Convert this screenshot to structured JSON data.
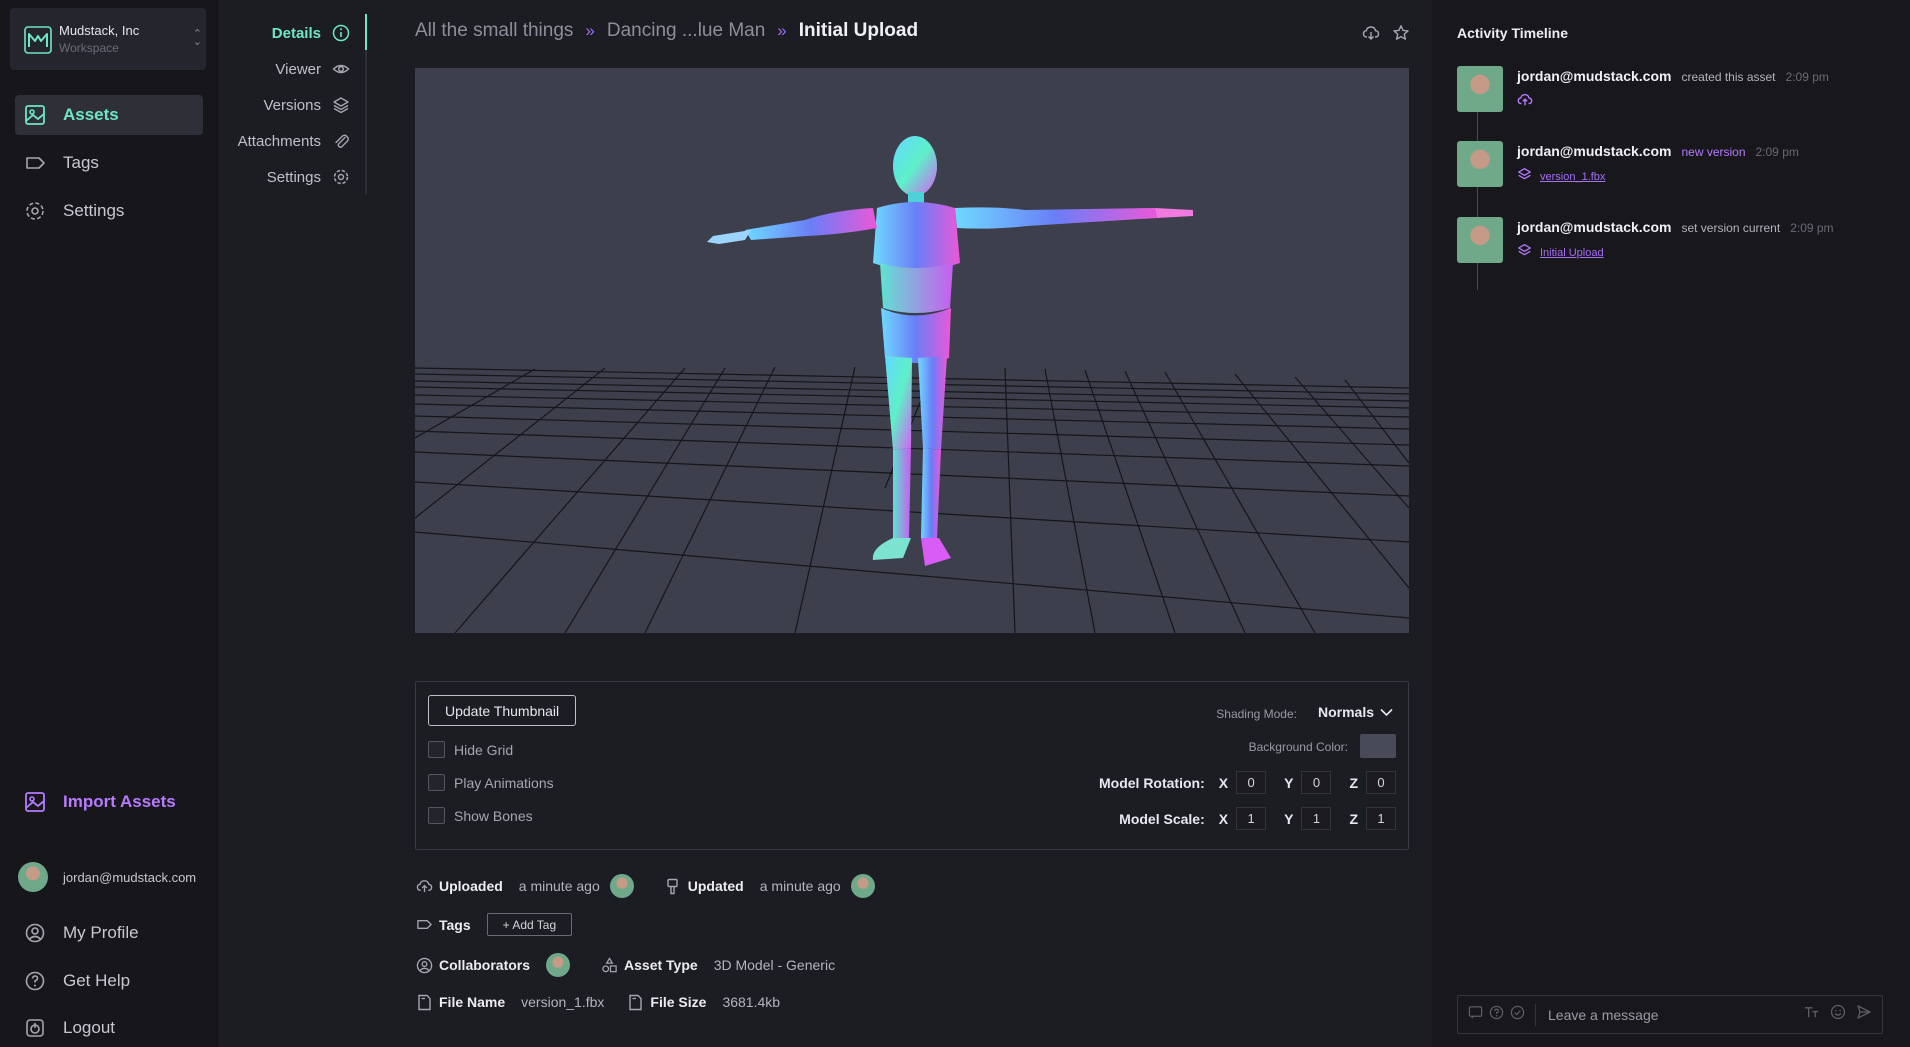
{
  "workspace": {
    "name": "Mudstack, Inc",
    "subtitle": "Workspace"
  },
  "sidebar": {
    "items": [
      {
        "label": "Assets",
        "icon": "image-icon",
        "active": true
      },
      {
        "label": "Tags",
        "icon": "tag-icon"
      },
      {
        "label": "Settings",
        "icon": "gear-icon"
      }
    ],
    "import_label": "Import Assets",
    "user_email": "jordan@mudstack.com",
    "bottom": [
      {
        "label": "My Profile",
        "icon": "user-circle-icon"
      },
      {
        "label": "Get Help",
        "icon": "help-circle-icon"
      },
      {
        "label": "Logout",
        "icon": "logout-icon"
      }
    ]
  },
  "detail_nav": [
    {
      "label": "Details",
      "icon": "info-icon",
      "active": true
    },
    {
      "label": "Viewer",
      "icon": "eye-icon"
    },
    {
      "label": "Versions",
      "icon": "layers-icon"
    },
    {
      "label": "Attachments",
      "icon": "paperclip-icon"
    },
    {
      "label": "Settings",
      "icon": "gear-icon"
    }
  ],
  "breadcrumb": {
    "items": [
      "All the small things",
      "Dancing ...lue Man"
    ],
    "current": "Initial Upload",
    "separator": "»"
  },
  "controls": {
    "update_thumbnail": "Update Thumbnail",
    "checkboxes": [
      "Hide Grid",
      "Play Animations",
      "Show Bones"
    ],
    "shading_label": "Shading Mode:",
    "shading_value": "Normals",
    "background_label": "Background Color:",
    "background_color": "#484a57",
    "rotation_label": "Model Rotation:",
    "rotation": {
      "x": "0",
      "y": "0",
      "z": "0"
    },
    "scale_label": "Model Scale:",
    "scale": {
      "x": "1",
      "y": "1",
      "z": "1"
    },
    "axis_labels": {
      "x": "X",
      "y": "Y",
      "z": "Z"
    }
  },
  "meta": {
    "uploaded_label": "Uploaded",
    "uploaded_value": "a minute ago",
    "updated_label": "Updated",
    "updated_value": "a minute ago",
    "tags_label": "Tags",
    "add_tag": "+ Add Tag",
    "collaborators_label": "Collaborators",
    "asset_type_label": "Asset Type",
    "asset_type_value": "3D Model - Generic",
    "file_name_label": "File Name",
    "file_name_value": "version_1.fbx",
    "file_size_label": "File Size",
    "file_size_value": "3681.4kb"
  },
  "activity": {
    "title": "Activity Timeline",
    "items": [
      {
        "user": "jordan@mudstack.com",
        "action": "created this asset",
        "time": "2:09 pm",
        "link": "",
        "icon": "cloud-upload-icon"
      },
      {
        "user": "jordan@mudstack.com",
        "action": "new version",
        "time": "2:09 pm",
        "link": "version_1.fbx",
        "icon": "layers-icon"
      },
      {
        "user": "jordan@mudstack.com",
        "action": "set version current",
        "time": "2:09 pm",
        "link": "Initial Upload",
        "icon": "layers-icon"
      }
    ],
    "message_placeholder": "Leave a message"
  },
  "colors": {
    "accent_green": "#6ee7c4",
    "accent_purple": "#b77bff",
    "viewer_bg": "#3e3f4c"
  }
}
